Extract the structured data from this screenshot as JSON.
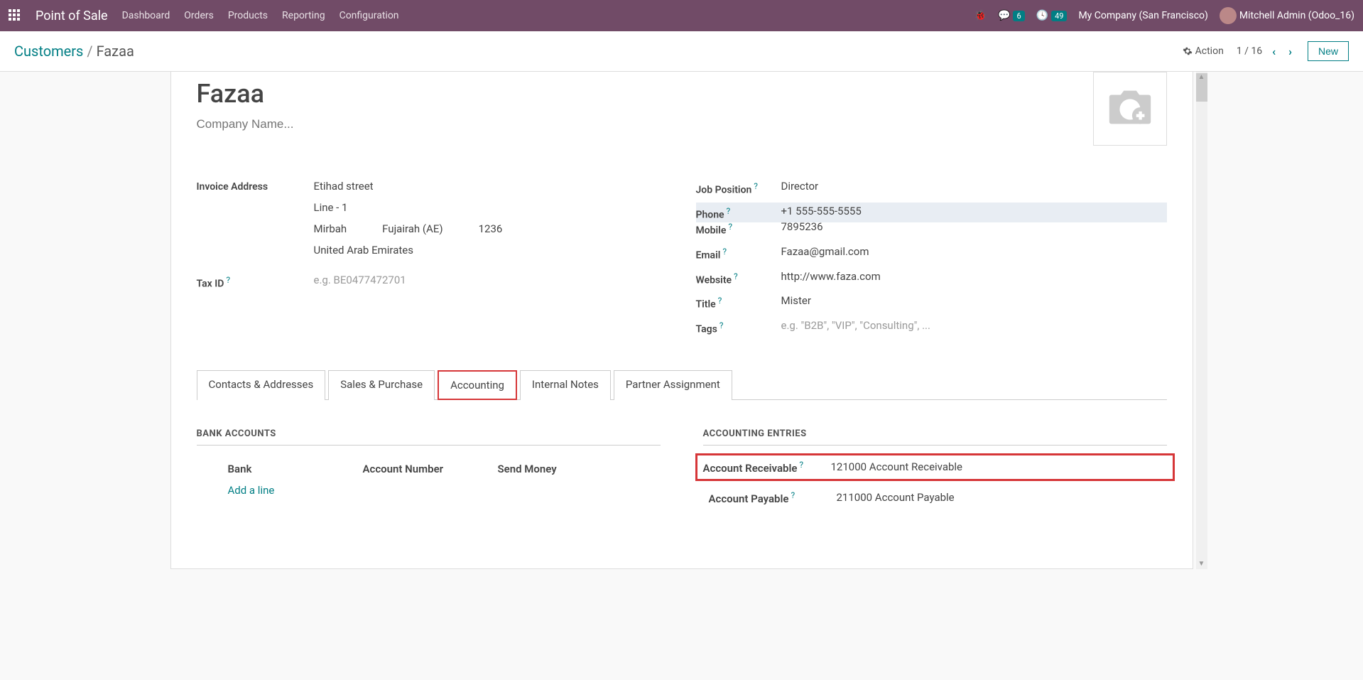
{
  "navbar": {
    "brand": "Point of Sale",
    "links": [
      "Dashboard",
      "Orders",
      "Products",
      "Reporting",
      "Configuration"
    ],
    "messages_badge": "6",
    "activity_badge": "49",
    "company": "My Company (San Francisco)",
    "user": "Mitchell Admin (Odoo_16)"
  },
  "breadcrumb": {
    "root": "Customers",
    "current": "Fazaa"
  },
  "subheader": {
    "action": "Action",
    "pager": "1 / 16",
    "new": "New"
  },
  "form": {
    "name": "Fazaa",
    "company_ph": "Company Name...",
    "address": {
      "label": "Invoice Address",
      "street": "Etihad street",
      "line2": "Line - 1",
      "city": "Mirbah",
      "state": "Fujairah (AE)",
      "zip": "1236",
      "country": "United Arab Emirates"
    },
    "tax_id": {
      "label": "Tax ID",
      "placeholder": "e.g. BE0477472701"
    },
    "right": {
      "job": {
        "label": "Job Position",
        "value": "Director"
      },
      "phone": {
        "label": "Phone",
        "value": "+1 555-555-5555"
      },
      "mobile": {
        "label": "Mobile",
        "value": "7895236"
      },
      "email": {
        "label": "Email",
        "value": "Fazaa@gmail.com"
      },
      "website": {
        "label": "Website",
        "value": "http://www.faza.com"
      },
      "title": {
        "label": "Title",
        "value": "Mister"
      },
      "tags": {
        "label": "Tags",
        "placeholder": "e.g. \"B2B\", \"VIP\", \"Consulting\", ..."
      }
    }
  },
  "tabs": [
    "Contacts & Addresses",
    "Sales & Purchase",
    "Accounting",
    "Internal Notes",
    "Partner Assignment"
  ],
  "active_tab": 2,
  "bank": {
    "section": "BANK ACCOUNTS",
    "cols": [
      "Bank",
      "Account Number",
      "Send Money"
    ],
    "add": "Add a line"
  },
  "accounting": {
    "section": "ACCOUNTING ENTRIES",
    "receivable": {
      "label": "Account Receivable",
      "value": "121000 Account Receivable"
    },
    "payable": {
      "label": "Account Payable",
      "value": "211000 Account Payable"
    }
  }
}
